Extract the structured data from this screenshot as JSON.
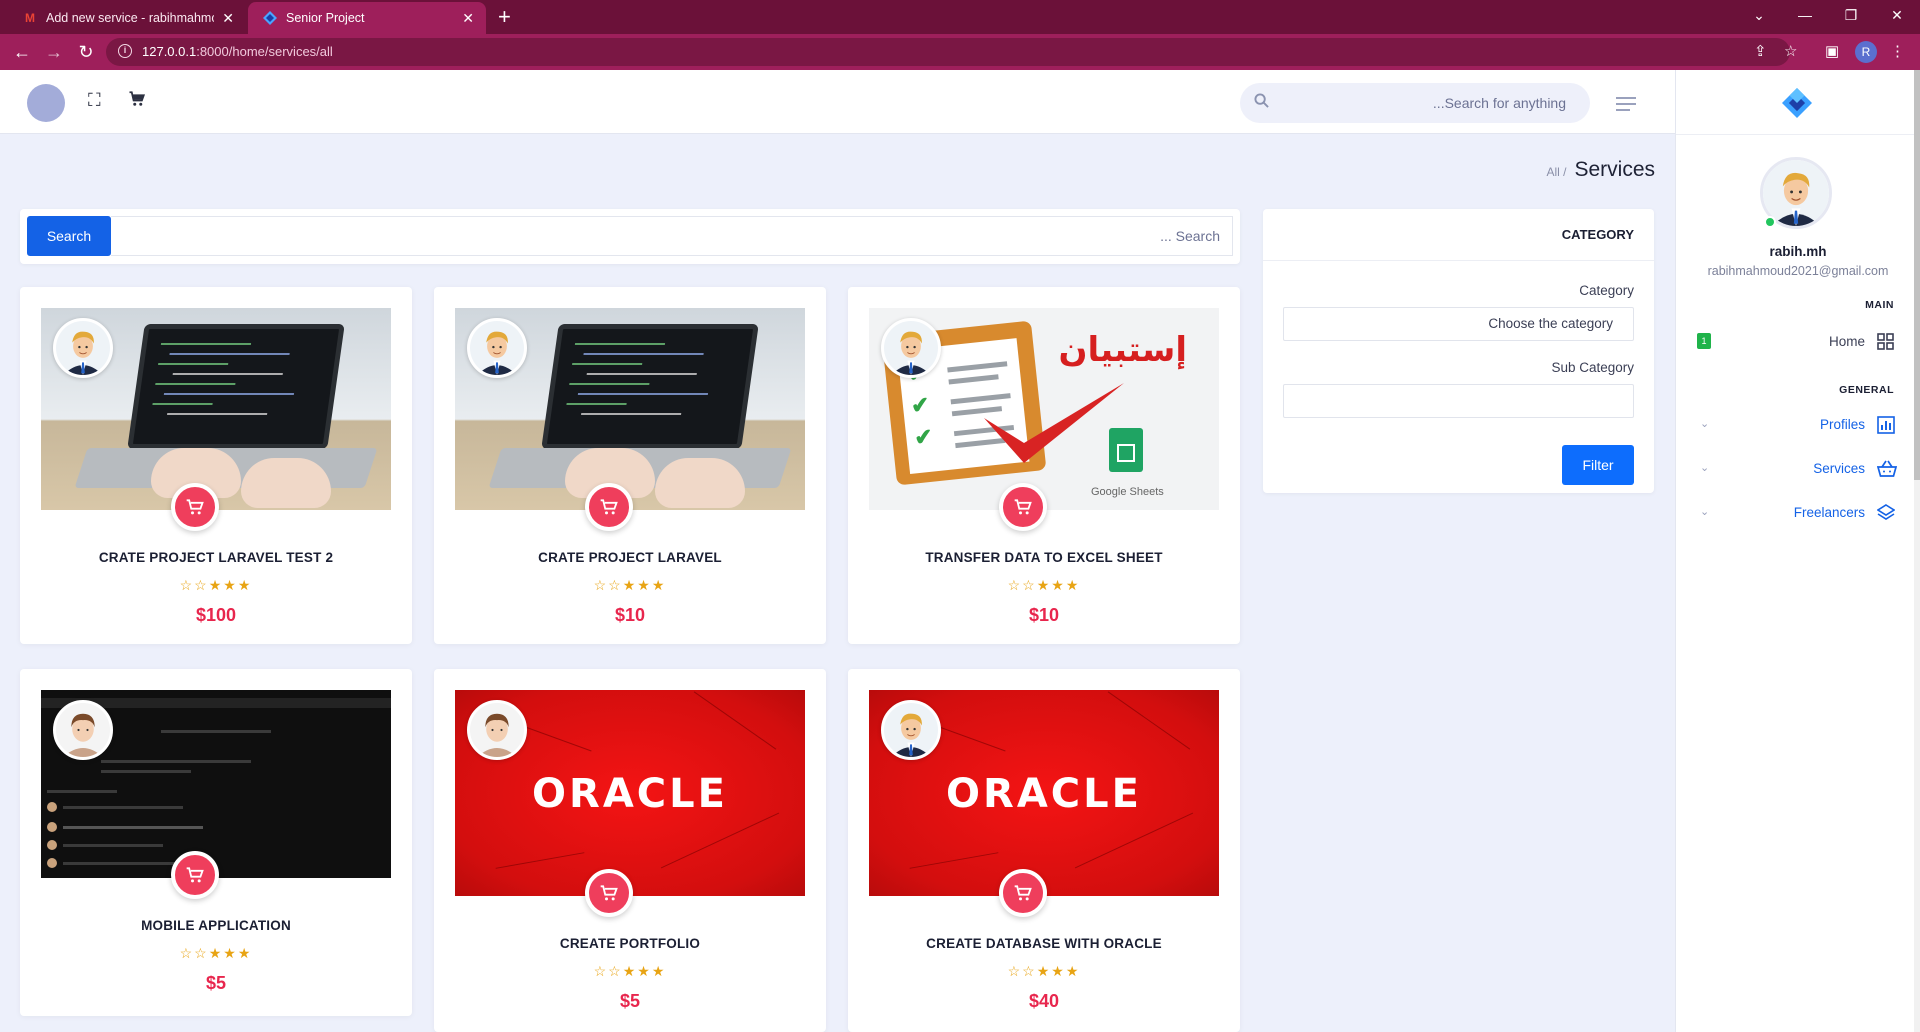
{
  "browser": {
    "tabs": [
      {
        "title": "Add new service - rabihmahmou",
        "favicon": "gmail-icon"
      },
      {
        "title": "Senior Project",
        "favicon": "app-icon"
      }
    ],
    "url_host": "127.0.0.1",
    "url_path": ":8000/home/services/all",
    "profile_initial": "R"
  },
  "header": {
    "search_placeholder": "...Search for anything"
  },
  "breadcrumb": {
    "parent": "All /",
    "current": "Services"
  },
  "search": {
    "button_label": "Search",
    "placeholder": "... Search"
  },
  "services": [
    {
      "title": "CRATE PROJECT LARAVEL TEST 2",
      "price": "$100",
      "stars": "☆☆★★★",
      "image": "laptop-code",
      "seller": "cartoon-man"
    },
    {
      "title": "CRATE PROJECT LARAVEL",
      "price": "$10",
      "stars": "☆☆★★★",
      "image": "laptop-code",
      "seller": "cartoon-man"
    },
    {
      "title": "TRANSFER DATA TO EXCEL SHEET",
      "price": "$10",
      "stars": "☆☆★★★",
      "image": "excel-survey",
      "image_text": "إستبيان",
      "image_caption": "Google Sheets",
      "seller": "cartoon-man"
    },
    {
      "title": "MOBILE APPLICATION",
      "price": "$5",
      "stars": "☆☆★★★",
      "image": "youtube-dark",
      "seller": "cartoon-boy"
    },
    {
      "title": "CREATE PORTFOLIO",
      "price": "$5",
      "stars": "☆☆★★★",
      "image": "oracle-red",
      "image_text": "ORACLE",
      "seller": "cartoon-boy"
    },
    {
      "title": "CREATE DATABASE WITH ORACLE",
      "price": "$40",
      "stars": "☆☆★★★",
      "image": "oracle-red",
      "image_text": "ORACLE",
      "seller": "cartoon-man"
    }
  ],
  "filter": {
    "heading": "CATEGORY",
    "category_label": "Category",
    "category_value": "Choose the category",
    "subcategory_label": "Sub Category",
    "subcategory_value": "",
    "button_label": "Filter"
  },
  "sidebar": {
    "user_name": "rabih.mh",
    "user_email": "rabihmahmoud2021@gmail.com",
    "main_heading": "MAIN",
    "general_heading": "GENERAL",
    "home_badge": "1",
    "items": [
      {
        "label": "Home",
        "icon": "grid-icon"
      },
      {
        "label": "Profiles",
        "icon": "chart-icon"
      },
      {
        "label": "Services",
        "icon": "basket-icon"
      },
      {
        "label": "Freelancers",
        "icon": "layers-icon"
      }
    ]
  },
  "colors": {
    "primary": "#1462e6",
    "accent": "#e8264d",
    "star": "#e8a414",
    "browser_frame": "#9e1f5b"
  }
}
